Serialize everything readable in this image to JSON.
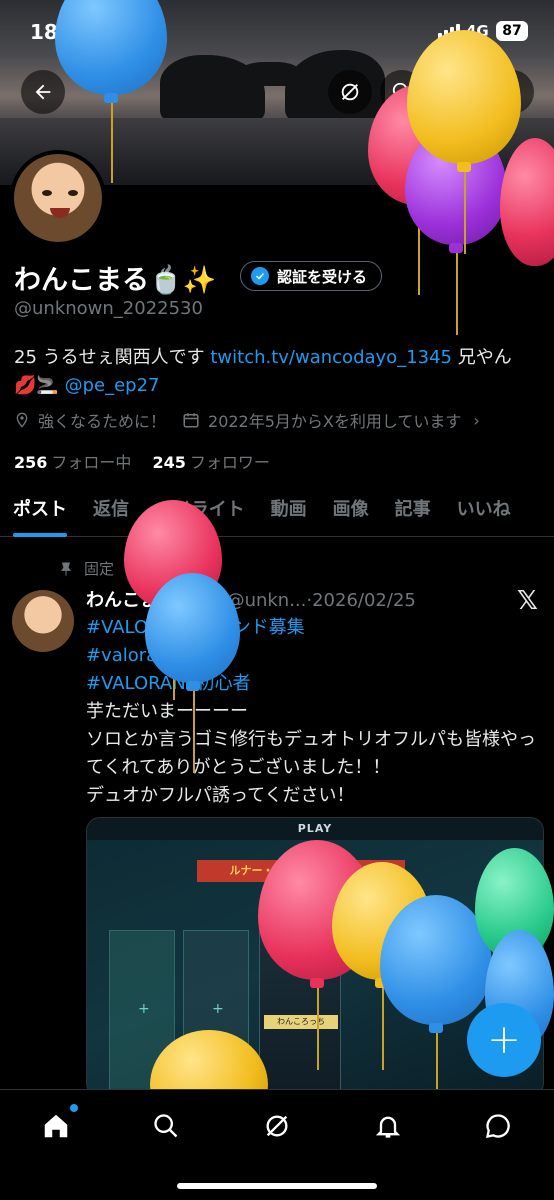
{
  "status_bar": {
    "time": "18:25",
    "network": "4G",
    "battery": "87"
  },
  "profile": {
    "name": "わんこまる🍵✨",
    "verify_button": "認証を受ける",
    "handle": "@unknown_2022530",
    "bio_prefix": "25 うるせぇ関西人です ",
    "bio_link": "twitch.tv/wancodayo_1345",
    "bio_suffix": " 兄やん 💋🚬",
    "bio_mention": "@pe_ep27",
    "location": "強くなるために！",
    "joined": "2022年5月からXを利用しています",
    "following_count": "256",
    "following_label": "フォロー中",
    "followers_count": "245",
    "followers_label": "フォロワー"
  },
  "tabs": [
    {
      "label": "ポスト"
    },
    {
      "label": "返信"
    },
    {
      "label": "ハイライト"
    },
    {
      "label": "動画"
    },
    {
      "label": "画像"
    },
    {
      "label": "記事"
    },
    {
      "label": "いいね"
    }
  ],
  "post": {
    "pinned_label": "固定",
    "author": "わんこまる🍵✨",
    "author_meta": "@unkn...·2026/02/25",
    "hashtags": [
      "#VALORANTフレンド募集",
      "#valorant募集pc",
      "#VALORANT初心者"
    ],
    "lines": [
      "芋ただいまーーーー",
      "ソロとか言うゴミ修行もデュオトリオフルパも皆様やってくれてありがとうございました！！",
      "デュオかフルパ誘ってください！"
    ],
    "image": {
      "topbar": "PLAY",
      "event_banner": "ルナー・ニューイベントパス",
      "card_name": "わんころっち"
    }
  },
  "colors": {
    "accent": "#1d9bf0",
    "background": "#000000",
    "muted": "#71767b"
  },
  "icons": {
    "back": "arrow-left-icon",
    "grok": "grok-icon",
    "search": "search-icon",
    "home": "home-icon",
    "notifications": "bell-icon",
    "messages": "message-icon",
    "compose": "plus-icon"
  }
}
